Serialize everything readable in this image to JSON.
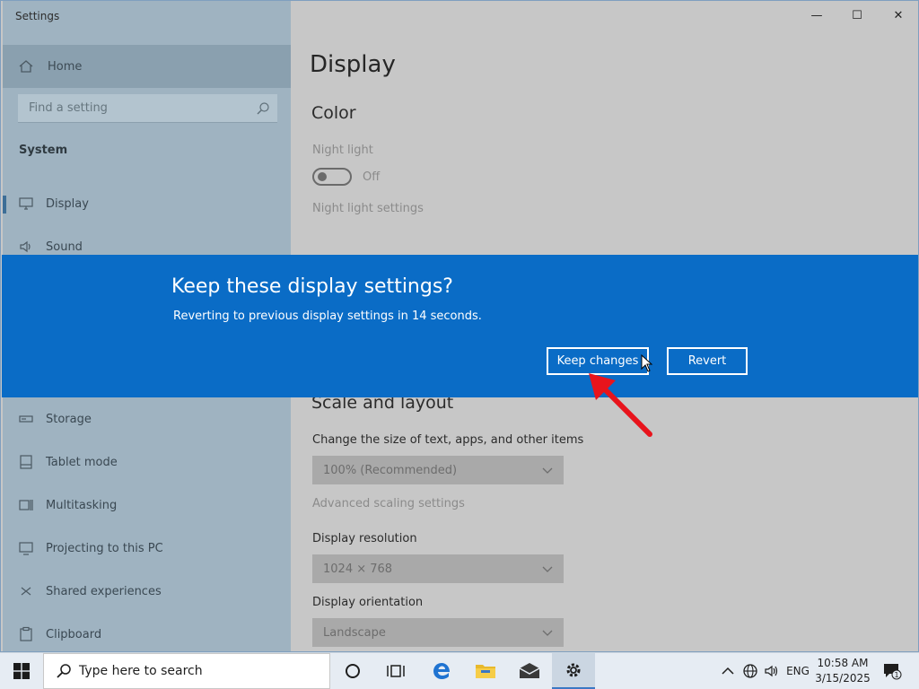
{
  "window": {
    "title": "Settings",
    "minimize": "—",
    "maximize": "☐",
    "close": "✕"
  },
  "sidebar": {
    "home": "Home",
    "search_placeholder": "Find a setting",
    "section": "System",
    "items": [
      {
        "label": "Display",
        "icon": "monitor-icon",
        "selected": true
      },
      {
        "label": "Sound",
        "icon": "speaker-icon"
      },
      {
        "label": "Storage",
        "icon": "storage-icon"
      },
      {
        "label": "Tablet mode",
        "icon": "tablet-icon"
      },
      {
        "label": "Multitasking",
        "icon": "multitasking-icon"
      },
      {
        "label": "Projecting to this PC",
        "icon": "projector-icon"
      },
      {
        "label": "Shared experiences",
        "icon": "shared-icon"
      },
      {
        "label": "Clipboard",
        "icon": "clipboard-icon"
      }
    ]
  },
  "main": {
    "title": "Display",
    "color_heading": "Color",
    "night_light_label": "Night light",
    "night_light_state": "Off",
    "night_light_settings": "Night light settings",
    "scale_heading": "Scale and layout",
    "scale_label": "Change the size of text, apps, and other items",
    "scale_value": "100% (Recommended)",
    "advanced_scaling": "Advanced scaling settings",
    "resolution_label": "Display resolution",
    "resolution_value": "1024 × 768",
    "orientation_label": "Display orientation",
    "orientation_value": "Landscape"
  },
  "dialog": {
    "title": "Keep these display settings?",
    "message": "Reverting to previous display settings in 14 seconds.",
    "keep_button": "Keep changes",
    "revert_button": "Revert"
  },
  "taskbar": {
    "search_placeholder": "Type here to search",
    "language": "ENG",
    "time": "10:58 AM",
    "date": "3/15/2025",
    "notification_count": "1"
  },
  "colors": {
    "dialog_blue": "#0a6cc6",
    "annotation_red": "#e8141c",
    "taskbar_bg": "#e6ecf3"
  }
}
